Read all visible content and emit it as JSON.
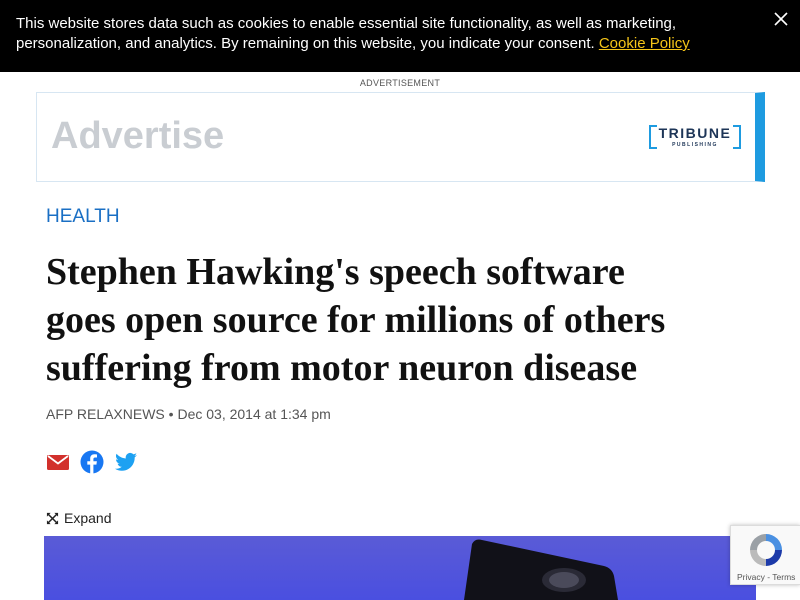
{
  "cookie_banner": {
    "text": "This website stores data such as cookies to enable essential site functionality, as well as marketing, personalization, and analytics. By remaining on this website, you indicate your consent.",
    "link_label": "Cookie Policy",
    "close_icon": "close-icon"
  },
  "advertisement": {
    "label": "ADVERTISEMENT",
    "placeholder_text": "Advertise",
    "brand_name": "TRIBUNE",
    "brand_sub": "PUBLISHING"
  },
  "article": {
    "category": "HEALTH",
    "headline_lines": [
      "Stephen Hawking's speech software",
      "goes open source for millions of others",
      "suffering from motor neuron disease"
    ],
    "author": "AFP RELAXNEWS",
    "separator": " • ",
    "date": "Dec 03, 2014 at 1:34 pm",
    "expand_label": "Expand"
  },
  "share": {
    "icons": [
      "email-icon",
      "facebook-icon",
      "twitter-icon"
    ]
  },
  "recaptcha": {
    "privacy": "Privacy",
    "dash": " - ",
    "terms": "Terms"
  },
  "colors": {
    "banner_bg": "#000000",
    "cookie_link": "#f5c518",
    "category": "#1a6fc4",
    "ad_accent": "#1e9be0",
    "email": "#d2302c",
    "facebook": "#1877f2",
    "twitter": "#1da1f2"
  }
}
